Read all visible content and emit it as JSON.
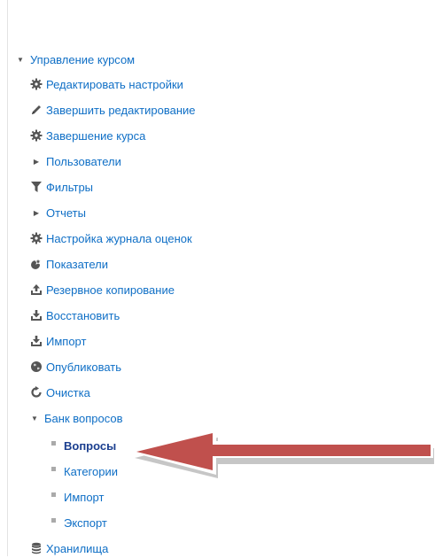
{
  "nav": {
    "course_admin": {
      "label": "Управление курсом",
      "items": [
        {
          "label": "Редактировать настройки",
          "icon": "gear-icon"
        },
        {
          "label": "Завершить редактирование",
          "icon": "pencil-icon"
        },
        {
          "label": "Завершение курса",
          "icon": "gear-icon"
        },
        {
          "label": "Пользователи",
          "icon": "collapsed-arrow-icon"
        },
        {
          "label": "Фильтры",
          "icon": "filter-icon"
        },
        {
          "label": "Отчеты",
          "icon": "collapsed-arrow-icon"
        },
        {
          "label": "Настройка журнала оценок",
          "icon": "gear-icon"
        },
        {
          "label": "Показатели",
          "icon": "badge-icon"
        },
        {
          "label": "Резервное копирование",
          "icon": "upload-tray-icon"
        },
        {
          "label": "Восстановить",
          "icon": "download-tray-icon"
        },
        {
          "label": "Импорт",
          "icon": "download-tray-icon"
        },
        {
          "label": "Опубликовать",
          "icon": "globe-icon"
        },
        {
          "label": "Очистка",
          "icon": "refresh-icon"
        }
      ]
    },
    "question_bank": {
      "label": "Банк вопросов",
      "items": [
        {
          "label": "Вопросы",
          "active": true
        },
        {
          "label": "Категории"
        },
        {
          "label": "Импорт"
        },
        {
          "label": "Экспорт"
        }
      ]
    },
    "repositories": {
      "label": "Хранилища",
      "icon": "database-icon"
    }
  },
  "colors": {
    "link": "#0f6fc6",
    "active_link": "#1a3e8f",
    "icon": "#555555",
    "arrow": "#c0504d"
  }
}
